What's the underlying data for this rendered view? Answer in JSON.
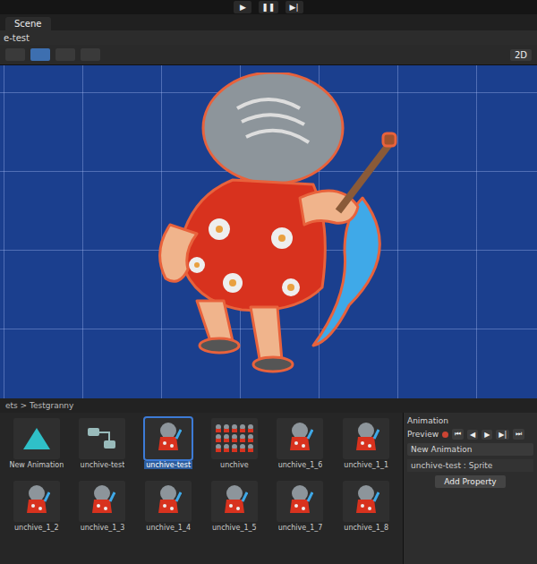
{
  "toolbar": {
    "buttons": [
      "▶",
      "❚❚",
      "▶|"
    ]
  },
  "tabs": [
    {
      "label": "Scene",
      "selected": true
    }
  ],
  "scene_title": "e-test",
  "scene_toolbar": {
    "mode": "2D"
  },
  "project": {
    "breadcrumb": "ets > Testgranny",
    "assets": [
      {
        "label": "New Animation",
        "kind": "animation",
        "selected": false
      },
      {
        "label": "unchive-test",
        "kind": "controller",
        "selected": false
      },
      {
        "label": "unchive-test",
        "kind": "sprite",
        "selected": true
      },
      {
        "label": "unchive",
        "kind": "sheet",
        "selected": false
      },
      {
        "label": "unchive_1_6",
        "kind": "frame",
        "selected": false
      },
      {
        "label": "unchive_1_1",
        "kind": "frame",
        "selected": false
      },
      {
        "label": "unchive_1_2",
        "kind": "frame",
        "selected": false
      },
      {
        "label": "unchive_1_3",
        "kind": "frame",
        "selected": false
      },
      {
        "label": "unchive_1_4",
        "kind": "frame",
        "selected": false
      },
      {
        "label": "unchive_1_5",
        "kind": "frame",
        "selected": false
      },
      {
        "label": "unchive_1_7",
        "kind": "frame",
        "selected": false
      },
      {
        "label": "unchive_1_8",
        "kind": "frame",
        "selected": false
      }
    ]
  },
  "animation": {
    "title": "Animation",
    "preview": "Preview",
    "controls": [
      "⏮",
      "◀",
      "▶",
      "▶|",
      "⏭"
    ],
    "clip": "New Animation",
    "property": "unchive-test : Sprite",
    "add_property": "Add Property"
  }
}
